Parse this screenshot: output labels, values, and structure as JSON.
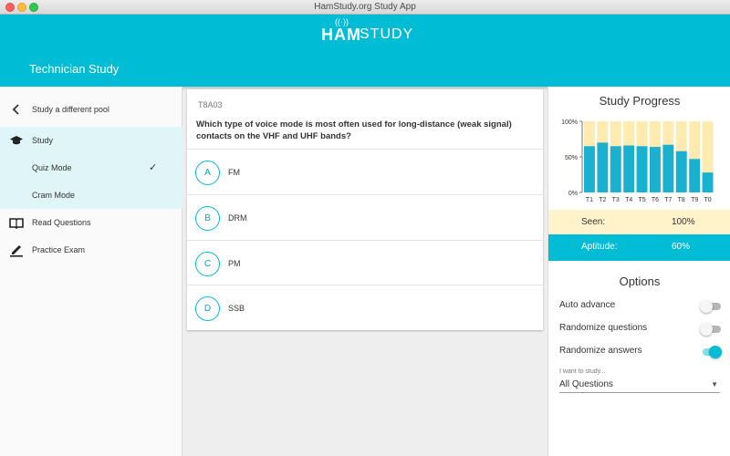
{
  "window": {
    "title": "HamStudy.org Study App"
  },
  "header": {
    "logo_ham": "HAM",
    "logo_study": "STUDY",
    "page_title": "Technician Study"
  },
  "sidebar": {
    "back_label": "Study a different pool",
    "study_label": "Study",
    "quiz_mode_label": "Quiz Mode",
    "cram_mode_label": "Cram Mode",
    "read_questions_label": "Read Questions",
    "practice_exam_label": "Practice Exam"
  },
  "question": {
    "id": "T8A03",
    "text": "Which type of voice mode is most often used for long-distance (weak signal) contacts on the VHF and UHF bands?",
    "answers": [
      {
        "letter": "A",
        "text": "FM"
      },
      {
        "letter": "B",
        "text": "DRM"
      },
      {
        "letter": "C",
        "text": "PM"
      },
      {
        "letter": "D",
        "text": "SSB"
      }
    ]
  },
  "progress": {
    "title": "Study Progress",
    "seen_label": "Seen:",
    "seen_value": "100%",
    "aptitude_label": "Aptitude:",
    "aptitude_value": "60%"
  },
  "chart_data": {
    "type": "bar",
    "categories": [
      "T1",
      "T2",
      "T3",
      "T4",
      "T5",
      "T6",
      "T7",
      "T8",
      "T9",
      "T0"
    ],
    "series": [
      {
        "values": [
          100,
          100,
          100,
          100,
          100,
          100,
          100,
          100,
          100,
          100
        ]
      },
      {
        "values": [
          65,
          70,
          65,
          66,
          65,
          64,
          67,
          58,
          47,
          28
        ]
      }
    ],
    "yticks": [
      "100%",
      "50%",
      "0%"
    ],
    "ylim": [
      0,
      100
    ],
    "colors": {
      "seen": "#ffeab0",
      "aptitude": "#1ab0cf"
    }
  },
  "options": {
    "title": "Options",
    "auto_advance": {
      "label": "Auto advance",
      "on": false
    },
    "randomize_questions": {
      "label": "Randomize questions",
      "on": false
    },
    "randomize_answers": {
      "label": "Randomize answers",
      "on": true
    },
    "study_select_label": "I want to study...",
    "study_select_value": "All Questions"
  },
  "colors": {
    "accent": "#00bcd4",
    "seen_bg": "#fff3cc"
  }
}
